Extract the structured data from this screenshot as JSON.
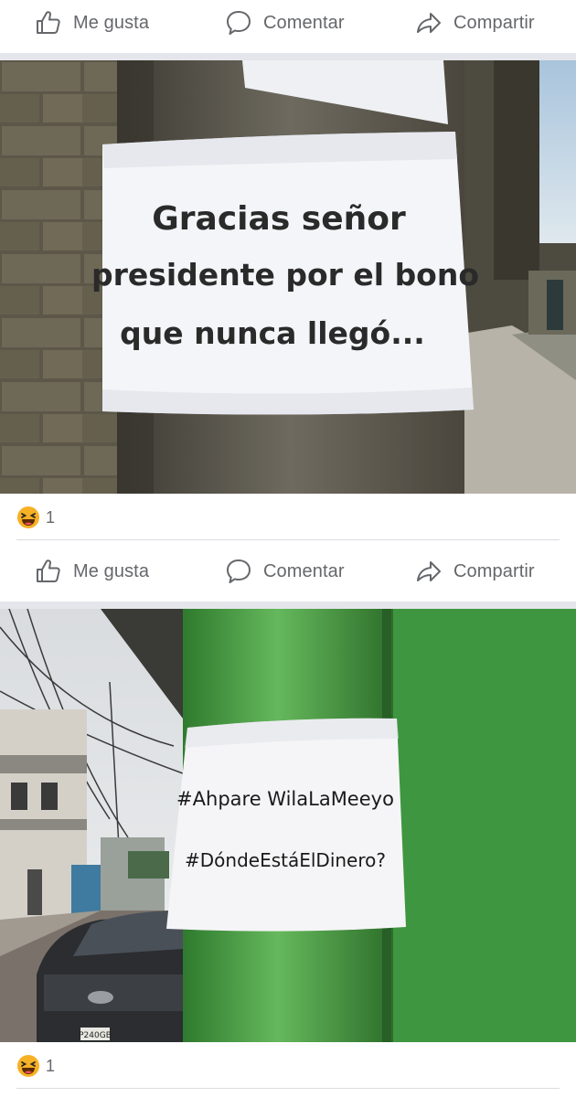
{
  "post_actions": {
    "like_label": "Me gusta",
    "comment_label": "Comentar",
    "share_label": "Compartir"
  },
  "posts": [
    {
      "photo_sign": {
        "lines": [
          "Gracias señor",
          "presidente por el bono",
          "que nunca llegó..."
        ]
      },
      "reactions": {
        "icon": "haha-emoji-icon",
        "count": "1"
      }
    },
    {
      "photo_sign": {
        "lines": [
          "#Ahpare WilaLaMeeyo",
          "#DóndeEstáElDinero?"
        ],
        "car_plate": "P240GB"
      },
      "reactions": {
        "icon": "haha-emoji-icon",
        "count": "1"
      }
    }
  ],
  "colors": {
    "action_text": "#65676b",
    "separator": "#e4e6eb",
    "haha_yellow": "#f7b125"
  }
}
